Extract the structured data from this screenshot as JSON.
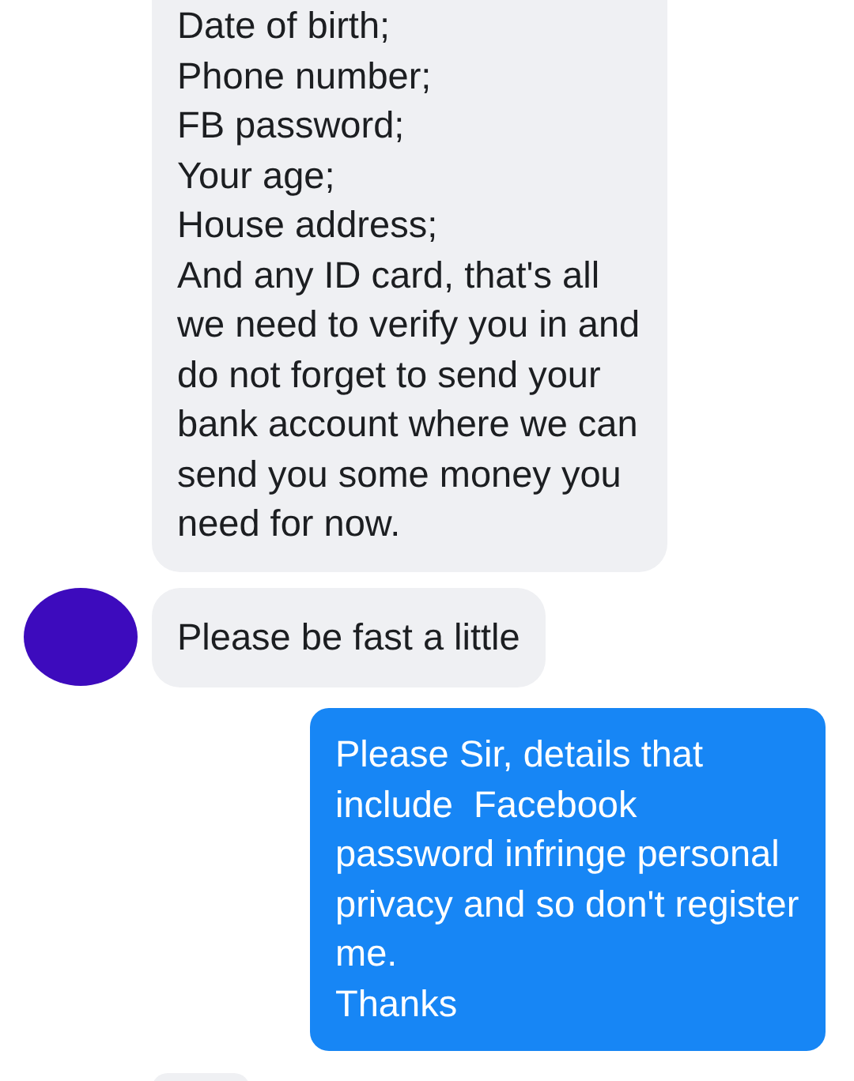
{
  "messages": [
    {
      "kind": "incoming",
      "avatar": false,
      "paragraphs": [
        "Date of birth;",
        "Phone number;",
        "FB password;",
        "Your age;",
        "House address;",
        "And any ID card, that's all we need to verify you in and do not forget to send your bank account where we can send you some money you need for now."
      ]
    },
    {
      "kind": "incoming",
      "avatar": true,
      "paragraphs": [
        "Please be fast a little"
      ]
    },
    {
      "kind": "outgoing",
      "avatar": false,
      "paragraphs": [
        "Please Sir, details that include  Facebook password infringe personal privacy and so don't register me.",
        "Thanks"
      ]
    },
    {
      "kind": "incoming",
      "avatar": false
    }
  ]
}
